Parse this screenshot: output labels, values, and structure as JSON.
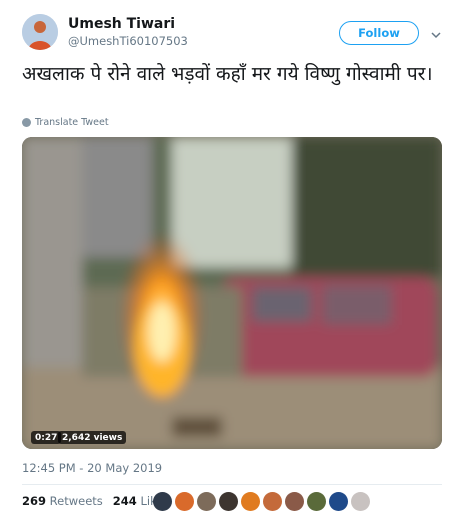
{
  "user": {
    "name": "Umesh Tiwari",
    "handle": "@UmeshTi60107503",
    "follow_label": "Follow"
  },
  "tweet": {
    "text": "अखलाक पे रोने वाले भड़वों कहाँ मर गये विष्णु गोस्वामी पर।",
    "translate_label": "Translate Tweet",
    "timestamp": "12:45 PM - 20 May 2019"
  },
  "video": {
    "duration": "0:27",
    "views": "2,642 views"
  },
  "stats": {
    "retweets_count": "269",
    "retweets_label": "Retweets",
    "likes_count": "244",
    "likes_label": "Likes"
  },
  "liker_avatars": [
    "#2f3a4a",
    "#d96a2b",
    "#7d6b5a",
    "#3d3530",
    "#e07b20",
    "#c46a3a",
    "#8a5a48",
    "#5a6a3a",
    "#1f4a8a",
    "#c8c2c0"
  ],
  "colors": {
    "accent": "#1da1f2",
    "secondary_text": "#657786",
    "primary_text": "#14171a"
  },
  "icons": {
    "caret": "chevron-down-icon",
    "translate": "globe-icon"
  }
}
